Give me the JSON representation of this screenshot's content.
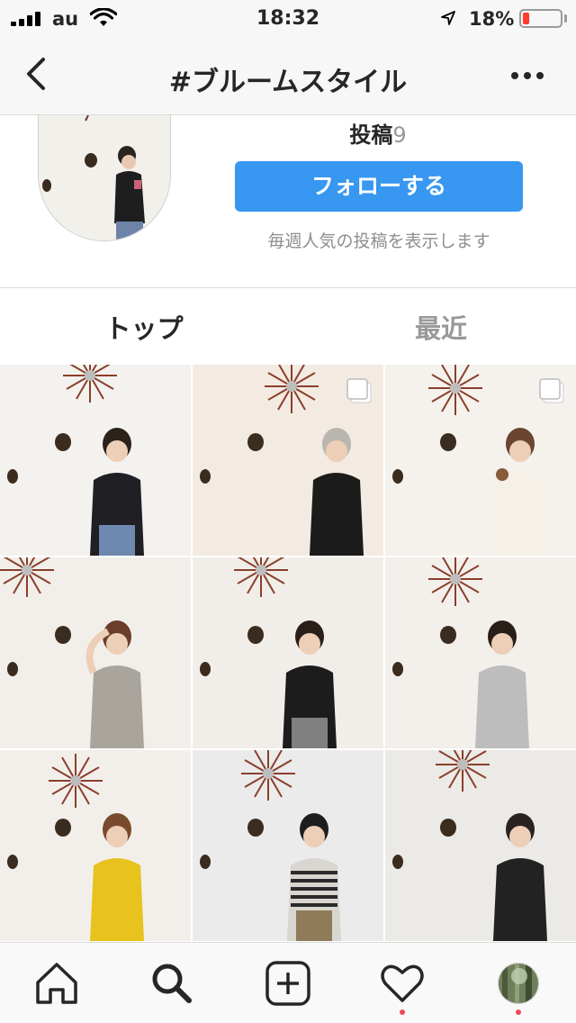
{
  "status_bar": {
    "carrier": "au",
    "time": "18:32",
    "battery_percent": "18%",
    "battery_level": 0.18,
    "icons": [
      "signal-icon",
      "wifi-icon",
      "location-arrow-icon",
      "battery-icon"
    ]
  },
  "nav": {
    "title": "#ブルームスタイル",
    "icons": [
      "back-chevron-icon",
      "more-options-icon"
    ]
  },
  "profile": {
    "posts_label": "投稿",
    "posts_count": "9",
    "follow_label": "フォローする",
    "description": "毎週人気の投稿を表示します"
  },
  "tabs": [
    {
      "label": "トップ",
      "active": true
    },
    {
      "label": "最近",
      "active": false
    }
  ],
  "grid": {
    "posts": [
      {
        "id": "post-1",
        "multi": false,
        "outfit": "black polka-dot blouse, jeans"
      },
      {
        "id": "post-2",
        "multi": true,
        "outfit": "black tunic, silver hair"
      },
      {
        "id": "post-3",
        "multi": true,
        "outfit": "white top, holding cup"
      },
      {
        "id": "post-4",
        "multi": false,
        "outfit": "grey tee, hand on head"
      },
      {
        "id": "post-5",
        "multi": false,
        "outfit": "black tee, jacket on arm"
      },
      {
        "id": "post-6",
        "multi": false,
        "outfit": "grey cardigan"
      },
      {
        "id": "post-7",
        "multi": false,
        "outfit": "yellow blouse"
      },
      {
        "id": "post-8",
        "multi": false,
        "outfit": "striped top, bag"
      },
      {
        "id": "post-9",
        "multi": false,
        "outfit": "black sleeveless top, glasses"
      }
    ]
  },
  "tab_bar": {
    "items": [
      "home-icon",
      "search-icon",
      "new-post-icon",
      "activity-heart-icon",
      "profile-avatar-icon"
    ],
    "notification_color": "#ed4956"
  },
  "colors": {
    "accent": "#3897f0",
    "battery_low": "#ff3b30"
  }
}
